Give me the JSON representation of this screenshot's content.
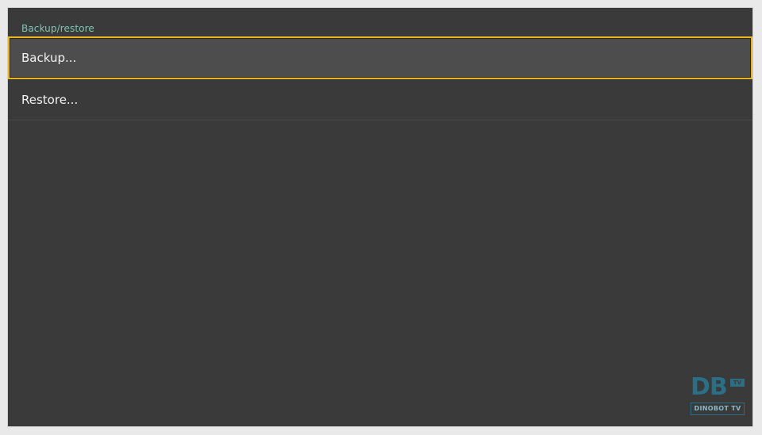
{
  "screen": {
    "section_title": "Backup/restore",
    "items": [
      {
        "label": "Backup...",
        "selected": true
      },
      {
        "label": "Restore...",
        "selected": false
      }
    ]
  },
  "watermark": {
    "letters": "DB",
    "badge": "TV",
    "name": "DINOBOT TV"
  },
  "colors": {
    "background": "#3a3a3a",
    "selected_background": "#4d4d4d",
    "focus_border": "#e8b423",
    "section_title": "#7fc6b5",
    "text": "#f2f2f2"
  }
}
